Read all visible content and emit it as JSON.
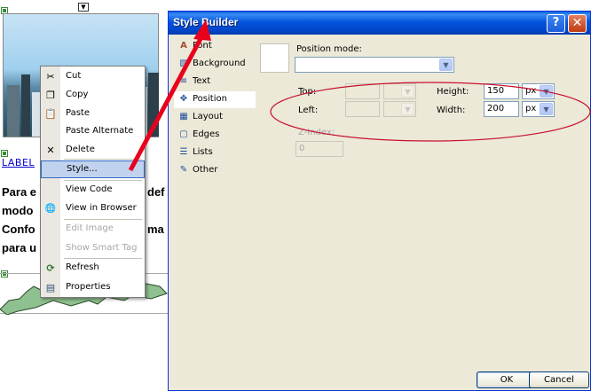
{
  "design_surface": {
    "label_link": "LABEL",
    "paragraph_lines": [
      "Para e",
      "modo",
      "Confo",
      "para u"
    ],
    "paragraph_right_fragments": [
      "def",
      "ma"
    ]
  },
  "context_menu": {
    "items": [
      {
        "label": "Cut",
        "icon": "scissors-icon",
        "glyph": "✂",
        "disabled": false
      },
      {
        "label": "Copy",
        "icon": "copy-icon",
        "glyph": "❐",
        "disabled": false
      },
      {
        "label": "Paste",
        "icon": "paste-icon",
        "glyph": "📋",
        "disabled": false
      },
      {
        "label": "Paste Alternate",
        "icon": "",
        "glyph": "",
        "disabled": false
      },
      {
        "label": "Delete",
        "icon": "delete-x-icon",
        "glyph": "✕",
        "disabled": false
      },
      {
        "label": "Style...",
        "icon": "",
        "glyph": "",
        "disabled": false,
        "selected": true
      },
      {
        "label": "View Code",
        "icon": "",
        "glyph": "",
        "disabled": false
      },
      {
        "label": "View in Browser",
        "icon": "browser-icon",
        "glyph": "🌐",
        "disabled": false
      },
      {
        "label": "Edit Image",
        "icon": "",
        "glyph": "",
        "disabled": true
      },
      {
        "label": "Show Smart Tag",
        "icon": "",
        "glyph": "",
        "disabled": true
      },
      {
        "label": "Refresh",
        "icon": "refresh-icon",
        "glyph": "⟳",
        "disabled": false
      },
      {
        "label": "Properties",
        "icon": "properties-icon",
        "glyph": "▤",
        "disabled": false
      }
    ]
  },
  "dialog": {
    "title": "Style Builder",
    "help_glyph": "?",
    "close_glyph": "✕",
    "nav_items": [
      {
        "label": "Font",
        "icon": "font-icon",
        "glyph": "A"
      },
      {
        "label": "Background",
        "icon": "background-icon",
        "glyph": "▧"
      },
      {
        "label": "Text",
        "icon": "text-icon",
        "glyph": "≡"
      },
      {
        "label": "Position",
        "icon": "position-icon",
        "glyph": "✥",
        "active": true
      },
      {
        "label": "Layout",
        "icon": "layout-icon",
        "glyph": "▦"
      },
      {
        "label": "Edges",
        "icon": "edges-icon",
        "glyph": "▢"
      },
      {
        "label": "Lists",
        "icon": "lists-icon",
        "glyph": "☰"
      },
      {
        "label": "Other",
        "icon": "other-icon",
        "glyph": "✎"
      }
    ],
    "position": {
      "mode_label": "Position mode:",
      "mode_value": "",
      "top_label": "Top:",
      "top_value": "",
      "left_label": "Left:",
      "left_value": "",
      "height_label": "Height:",
      "height_value": "150",
      "height_unit": "px",
      "width_label": "Width:",
      "width_value": "200",
      "width_unit": "px",
      "zindex_label": "Z-Index:",
      "zindex_value": "0"
    },
    "ok_label": "OK",
    "cancel_label": "Cancel"
  },
  "annotation_colors": {
    "arrow": "#e8001c",
    "ellipse": "#c8102e"
  }
}
